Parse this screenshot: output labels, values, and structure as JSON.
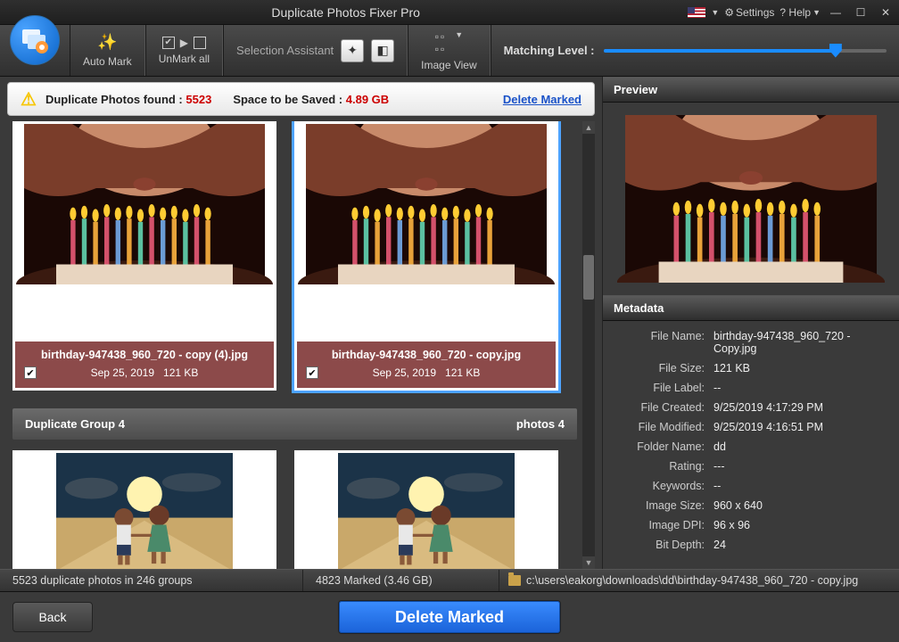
{
  "titlebar": {
    "title": "Duplicate Photos Fixer Pro",
    "settings": "Settings",
    "help": "? Help"
  },
  "toolbar": {
    "auto_mark": "Auto Mark",
    "unmark_all": "UnMark all",
    "selection_assistant": "Selection Assistant",
    "image_view": "Image View",
    "matching_level": "Matching Level :"
  },
  "summary": {
    "found_label": "Duplicate Photos found :",
    "found_count": "5523",
    "space_label": "Space to be Saved :",
    "space_value": "4.89 GB",
    "delete_marked": "Delete Marked"
  },
  "thumbs": {
    "card1": {
      "filename": "birthday-947438_960_720 - copy (4).jpg",
      "date": "Sep 25, 2019",
      "size": "121 KB"
    },
    "card2": {
      "filename": "birthday-947438_960_720 - copy.jpg",
      "date": "Sep 25, 2019",
      "size": "121 KB"
    },
    "group4": {
      "title": "Duplicate Group 4",
      "count": "photos 4"
    }
  },
  "preview": {
    "title": "Preview"
  },
  "metadata": {
    "title": "Metadata",
    "rows": {
      "file_name_k": "File Name:",
      "file_name_v": "birthday-947438_960_720 - Copy.jpg",
      "file_size_k": "File Size:",
      "file_size_v": "121 KB",
      "file_label_k": "File Label:",
      "file_label_v": "--",
      "file_created_k": "File Created:",
      "file_created_v": "9/25/2019 4:17:29 PM",
      "file_modified_k": "File Modified:",
      "file_modified_v": "9/25/2019 4:16:51 PM",
      "folder_name_k": "Folder Name:",
      "folder_name_v": "dd",
      "rating_k": "Rating:",
      "rating_v": "---",
      "keywords_k": "Keywords:",
      "keywords_v": "--",
      "image_size_k": "Image Size:",
      "image_size_v": "960 x 640",
      "image_dpi_k": "Image DPI:",
      "image_dpi_v": "96 x 96",
      "bit_depth_k": "Bit Depth:",
      "bit_depth_v": "24"
    }
  },
  "status": {
    "groups": "5523 duplicate photos in 246 groups",
    "marked": "4823 Marked (3.46 GB)",
    "path": "c:\\users\\eakorg\\downloads\\dd\\birthday-947438_960_720 - copy.jpg"
  },
  "buttons": {
    "back": "Back",
    "delete_marked": "Delete Marked"
  }
}
